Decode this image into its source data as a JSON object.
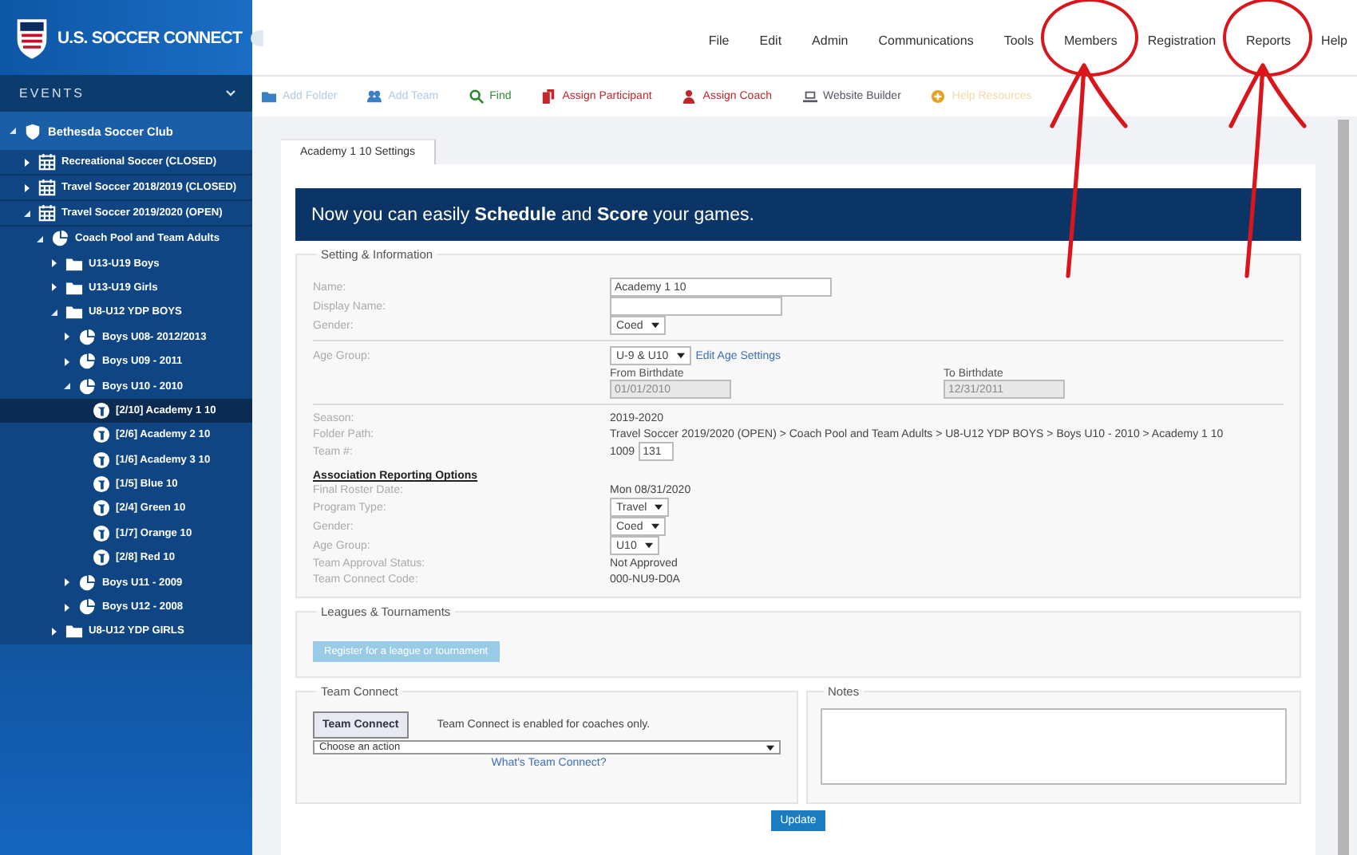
{
  "brand": {
    "title": "U.S. SOCCER CONNECT"
  },
  "sidebar": {
    "heading": "EVENTS",
    "tree": [
      {
        "label": "Bethesda Soccer Club",
        "kind": "club",
        "expanded": true,
        "selected": false,
        "children": [
          {
            "label": "Recreational Soccer (CLOSED)",
            "kind": "season",
            "expanded": false,
            "selected": false
          },
          {
            "label": "Travel Soccer 2018/2019 (CLOSED)",
            "kind": "season",
            "expanded": false,
            "selected": false
          },
          {
            "label": "Travel Soccer 2019/2020 (OPEN)",
            "kind": "season",
            "expanded": true,
            "selected": false,
            "children": [
              {
                "label": "Coach Pool and Team Adults",
                "kind": "group",
                "expanded": true,
                "selected": false,
                "children": [
                  {
                    "label": "U13-U19 Boys",
                    "kind": "folder",
                    "expanded": false,
                    "selected": false
                  },
                  {
                    "label": "U13-U19 Girls",
                    "kind": "folder",
                    "expanded": false,
                    "selected": false
                  },
                  {
                    "label": "U8-U12 YDP BOYS",
                    "kind": "folder",
                    "expanded": true,
                    "selected": false,
                    "children": [
                      {
                        "label": "Boys U08- 2012/2013",
                        "kind": "group",
                        "expanded": false,
                        "selected": false
                      },
                      {
                        "label": "Boys U09 - 2011",
                        "kind": "group",
                        "expanded": false,
                        "selected": false
                      },
                      {
                        "label": "Boys U10 - 2010",
                        "kind": "group",
                        "expanded": true,
                        "selected": false,
                        "children": [
                          {
                            "label": "[2/10]  Academy 1 10",
                            "kind": "team",
                            "selected": true
                          },
                          {
                            "label": "[2/6]  Academy 2 10",
                            "kind": "team",
                            "selected": false
                          },
                          {
                            "label": "[1/6]  Academy 3 10",
                            "kind": "team",
                            "selected": false
                          },
                          {
                            "label": "[1/5]  Blue 10",
                            "kind": "team",
                            "selected": false
                          },
                          {
                            "label": "[2/4]  Green 10",
                            "kind": "team",
                            "selected": false
                          },
                          {
                            "label": "[1/7]  Orange 10",
                            "kind": "team",
                            "selected": false
                          },
                          {
                            "label": "[2/8]  Red 10",
                            "kind": "team",
                            "selected": false
                          }
                        ]
                      },
                      {
                        "label": "Boys U11 - 2009",
                        "kind": "group",
                        "expanded": false,
                        "selected": false
                      },
                      {
                        "label": "Boys U12 - 2008",
                        "kind": "group",
                        "expanded": false,
                        "selected": false
                      }
                    ]
                  },
                  {
                    "label": "U8-U12 YDP GIRLS",
                    "kind": "folder",
                    "expanded": false,
                    "selected": false
                  }
                ]
              }
            ]
          }
        ]
      }
    ]
  },
  "menu": [
    {
      "label": "File",
      "circled": false
    },
    {
      "label": "Edit",
      "circled": false
    },
    {
      "label": "Admin",
      "circled": false
    },
    {
      "label": "Communications",
      "circled": false
    },
    {
      "label": "Tools",
      "circled": false
    },
    {
      "label": "Members",
      "circled": true
    },
    {
      "label": "Registration",
      "circled": false
    },
    {
      "label": "Reports",
      "circled": true
    },
    {
      "label": "Help",
      "circled": false
    }
  ],
  "toolbar": [
    {
      "label": "Add Folder",
      "color": "#3a7fc4",
      "disabled": true
    },
    {
      "label": "Add Team",
      "color": "#3a7fc4",
      "disabled": true
    },
    {
      "label": "Find",
      "color": "#2e8b2e",
      "disabled": false
    },
    {
      "label": "Assign Participant",
      "color": "#c0282d",
      "disabled": false
    },
    {
      "label": "Assign Coach",
      "color": "#c0282d",
      "disabled": false
    },
    {
      "label": "Website Builder",
      "color": "#555566",
      "disabled": false
    },
    {
      "label": "Help Resources",
      "color": "#e8a020",
      "disabled": true
    }
  ],
  "tab": {
    "label": "Academy 1 10 Settings",
    "selected": true
  },
  "banner": "Now you can easily **Schedule** and **Score** your games.",
  "settings": {
    "legend": "Setting & Information",
    "name": {
      "label": "Name:",
      "value": "Academy 1 10"
    },
    "display_name": {
      "label": "Display Name:"
    },
    "gender": {
      "label": "Gender:",
      "value": "Coed"
    },
    "age_group": {
      "label": "Age Group:",
      "value": "U-9 & U10",
      "link": "Edit Age Settings"
    },
    "from_birthdate": {
      "label": "From Birthdate",
      "value": "01/01/2010"
    },
    "to_birthdate": {
      "label": "To Birthdate",
      "value": "12/31/2011"
    },
    "season": {
      "label": "Season:",
      "value": "2019-2020"
    },
    "folder_path": {
      "label": "Folder Path:",
      "value": "Travel Soccer 2019/2020 (OPEN) > Coach Pool and Team Adults > U8-U12 YDP BOYS > Boys U10 - 2010 > Academy 1 10"
    },
    "team_number": {
      "label": "Team #:",
      "prefix": "1009",
      "value": "131"
    },
    "reporting": {
      "heading": "Association Reporting Options",
      "rows": [
        {
          "label": "Final Roster Date:",
          "kind": "text",
          "value": "Mon 08/31/2020"
        },
        {
          "label": "Program Type:",
          "kind": "select",
          "value": "Travel"
        },
        {
          "label": "Gender:",
          "kind": "select",
          "value": "Coed"
        },
        {
          "label": "Age Group:",
          "kind": "select",
          "value": "U10"
        },
        {
          "label": "Team Approval Status:",
          "kind": "text",
          "value": "Not Approved"
        },
        {
          "label": "Team Connect Code:",
          "kind": "text",
          "value": "000-NU9-D0A"
        }
      ]
    }
  },
  "leagues": {
    "legend": "Leagues & Tournaments",
    "button": "Register for a league or tournament",
    "disabled": true
  },
  "team_connect": {
    "legend": "Team Connect",
    "button": "Team Connect",
    "note": "Team Connect is enabled for coaches only.",
    "action": "Choose an action",
    "link": "What's Team Connect?"
  },
  "notes": {
    "legend": "Notes"
  },
  "update_button": "Update"
}
